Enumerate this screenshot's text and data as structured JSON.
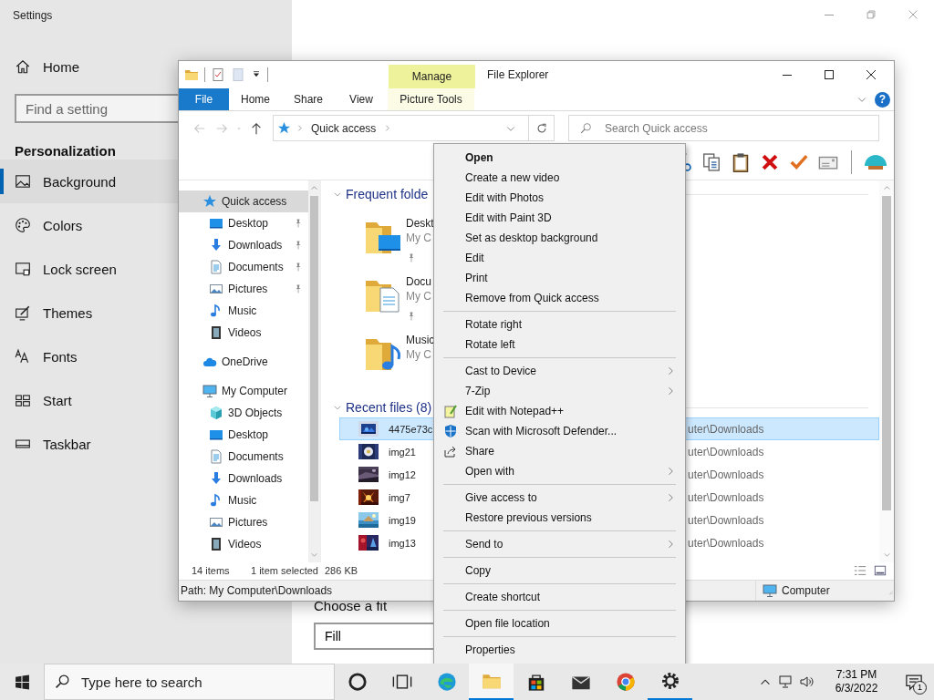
{
  "settings": {
    "title": "Settings",
    "home": "Home",
    "search": {
      "placeholder": "Find a setting"
    },
    "section": "Personalization",
    "nav": [
      {
        "label": "Background",
        "selected": true
      },
      {
        "label": "Colors",
        "selected": false
      },
      {
        "label": "Lock screen",
        "selected": false
      },
      {
        "label": "Themes",
        "selected": false
      },
      {
        "label": "Fonts",
        "selected": false
      },
      {
        "label": "Start",
        "selected": false
      },
      {
        "label": "Taskbar",
        "selected": false
      }
    ],
    "fit": {
      "label": "Choose a fit",
      "value": "Fill"
    }
  },
  "explorer": {
    "title": "File Explorer",
    "context_group": "Manage",
    "help": "?",
    "tabs": [
      {
        "label": "File",
        "kind": "file",
        "selected": false
      },
      {
        "label": "Home",
        "kind": "tab",
        "selected": false
      },
      {
        "label": "Share",
        "kind": "tab",
        "selected": false
      },
      {
        "label": "View",
        "kind": "tab",
        "selected": false
      },
      {
        "label": "Picture Tools",
        "kind": "contextual",
        "selected": false
      }
    ],
    "address": {
      "location": "Quick access"
    },
    "search": {
      "placeholder": "Search Quick access"
    },
    "nav": [
      {
        "label": "Quick access",
        "selected": true,
        "children": [
          {
            "label": "Desktop",
            "selected": false,
            "pinned": true
          },
          {
            "label": "Downloads",
            "selected": false,
            "pinned": true
          },
          {
            "label": "Documents",
            "selected": false,
            "pinned": true
          },
          {
            "label": "Pictures",
            "selected": false,
            "pinned": true
          },
          {
            "label": "Music",
            "selected": false,
            "pinned": false
          },
          {
            "label": "Videos",
            "selected": false,
            "pinned": false
          }
        ]
      },
      {
        "label": "OneDrive",
        "selected": false
      },
      {
        "label": "My Computer",
        "selected": false,
        "children": [
          {
            "label": "3D Objects",
            "selected": false,
            "pinned": false
          },
          {
            "label": "Desktop",
            "selected": false,
            "pinned": false
          },
          {
            "label": "Documents",
            "selected": false,
            "pinned": false
          },
          {
            "label": "Downloads",
            "selected": false,
            "pinned": false
          },
          {
            "label": "Music",
            "selected": false,
            "pinned": false
          },
          {
            "label": "Pictures",
            "selected": false,
            "pinned": false
          },
          {
            "label": "Videos",
            "selected": false,
            "pinned": false
          }
        ]
      }
    ],
    "frequent": {
      "heading": "Frequent folde",
      "folders": [
        {
          "name": "Deskt",
          "location": "My C",
          "pinned": true
        },
        {
          "name": "Docu",
          "location": "My C",
          "pinned": true
        },
        {
          "name": "Music",
          "location": "My C",
          "pinned": false
        }
      ]
    },
    "recent": {
      "heading": "Recent files (8)",
      "files": [
        {
          "name": "4475e73c",
          "location": "uter\\Downloads",
          "selected": true
        },
        {
          "name": "img21",
          "location": "uter\\Downloads",
          "selected": false
        },
        {
          "name": "img12",
          "location": "uter\\Downloads",
          "selected": false
        },
        {
          "name": "img7",
          "location": "uter\\Downloads",
          "selected": false
        },
        {
          "name": "img19",
          "location": "uter\\Downloads",
          "selected": false
        },
        {
          "name": "img13",
          "location": "uter\\Downloads",
          "selected": false
        }
      ]
    },
    "status": {
      "count": "14 items",
      "selection": "1 item selected",
      "size": "286 KB"
    },
    "details_bar": {
      "path": "Path: My Computer\\Downloads",
      "zone": "Computer"
    }
  },
  "context_menu": [
    {
      "label": "Open",
      "kind": "default"
    },
    {
      "label": "Create a new video",
      "kind": "item"
    },
    {
      "label": "Edit with Photos",
      "kind": "item"
    },
    {
      "label": "Edit with Paint 3D",
      "kind": "item"
    },
    {
      "label": "Set as desktop background",
      "kind": "item"
    },
    {
      "label": "Edit",
      "kind": "item"
    },
    {
      "label": "Print",
      "kind": "item"
    },
    {
      "label": "Remove from Quick access",
      "kind": "item"
    },
    {
      "kind": "separator"
    },
    {
      "label": "Rotate right",
      "kind": "item"
    },
    {
      "label": "Rotate left",
      "kind": "item"
    },
    {
      "kind": "separator"
    },
    {
      "label": "Cast to Device",
      "kind": "submenu"
    },
    {
      "label": "7-Zip",
      "kind": "submenu"
    },
    {
      "label": "Edit with Notepad++",
      "kind": "item"
    },
    {
      "label": "Scan with Microsoft Defender...",
      "kind": "item"
    },
    {
      "label": "Share",
      "kind": "item"
    },
    {
      "label": "Open with",
      "kind": "submenu"
    },
    {
      "kind": "separator"
    },
    {
      "label": "Give access to",
      "kind": "submenu"
    },
    {
      "label": "Restore previous versions",
      "kind": "item"
    },
    {
      "kind": "separator"
    },
    {
      "label": "Send to",
      "kind": "submenu"
    },
    {
      "kind": "separator"
    },
    {
      "label": "Copy",
      "kind": "item"
    },
    {
      "kind": "separator"
    },
    {
      "label": "Create shortcut",
      "kind": "item"
    },
    {
      "kind": "separator"
    },
    {
      "label": "Open file location",
      "kind": "item"
    },
    {
      "kind": "separator"
    },
    {
      "label": "Properties",
      "kind": "item"
    }
  ],
  "taskbar": {
    "search": {
      "placeholder": "Type here to search"
    },
    "apps": [
      {
        "running": false,
        "selected": false
      },
      {
        "running": false,
        "selected": false
      },
      {
        "running": false,
        "selected": false
      },
      {
        "running": true,
        "selected": true
      },
      {
        "running": false,
        "selected": false
      },
      {
        "running": false,
        "selected": false
      },
      {
        "running": false,
        "selected": false
      },
      {
        "running": true,
        "selected": false
      }
    ],
    "time": "7:31 PM",
    "date": "6/3/2022",
    "notifications": "1"
  }
}
